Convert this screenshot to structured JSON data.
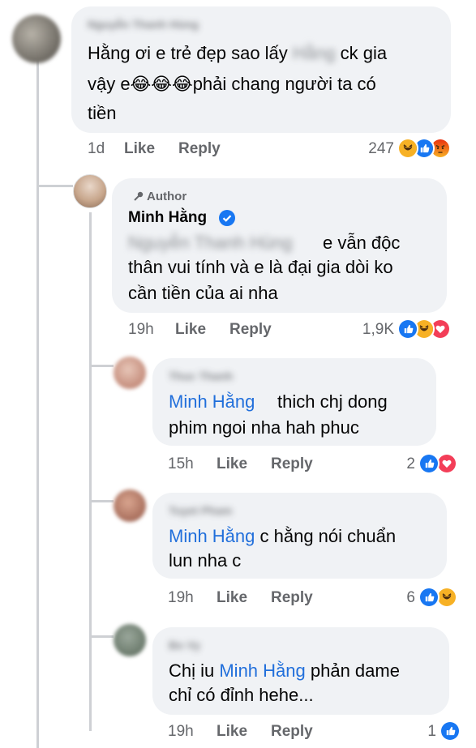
{
  "comments": [
    {
      "name": "Nguyễn Thanh Hùng",
      "line1_pre": "Hằng ơi e trẻ đẹp sao lấy ",
      "line1_blur": "Hằng",
      "line1_post": " ck gia",
      "line2": "vậy e😂😂😂phải chang người ta có",
      "line3": "tiền",
      "time": "1d",
      "like": "Like",
      "reply": "Reply",
      "reaction_count": "247",
      "reactions": [
        "haha",
        "like",
        "angry"
      ]
    },
    {
      "author_badge": "Author",
      "name": "Minh Hằng",
      "line1_blur": "Nguyễn Thanh Hùng",
      "line1_post": "e vẫn độc",
      "line2": "thân vui tính và e là đại gia dòi ko",
      "line3": "cần tiền của ai nha",
      "time": "19h",
      "like": "Like",
      "reply": "Reply",
      "reaction_count": "1,9K",
      "reactions": [
        "like",
        "haha",
        "love"
      ]
    },
    {
      "name": "Thuc Thanh",
      "mention": "Minh Hằng",
      "line1_post": "thich chj dong",
      "line2": "phim ngoi nha hah phuc",
      "time": "15h",
      "like": "Like",
      "reply": "Reply",
      "reaction_count": "2",
      "reactions": [
        "like",
        "love"
      ]
    },
    {
      "name": "Tuyet Pham",
      "mention": "Minh Hằng",
      "line1_post": " c hằng nói chuẩn",
      "line2": "lun nha c",
      "time": "19h",
      "like": "Like",
      "reply": "Reply",
      "reaction_count": "6",
      "reactions": [
        "like",
        "haha"
      ]
    },
    {
      "name": "Bo Vy",
      "line1_pre": "Chị iu ",
      "mention": "Minh Hằng",
      "line1_post": " phản dame",
      "line2": "chỉ có đỉnh hehe...",
      "time": "19h",
      "like": "Like",
      "reply": "Reply",
      "reaction_count": "1",
      "reactions": [
        "like"
      ]
    }
  ],
  "colors": {
    "bubble": "#f0f2f5",
    "meta_text": "#65676b",
    "mention": "#216fdb",
    "like_blue": "#1877f2",
    "love_red": "#f33e58",
    "haha_yellow": "#f7b125",
    "angry_orange": "#e9710f"
  }
}
